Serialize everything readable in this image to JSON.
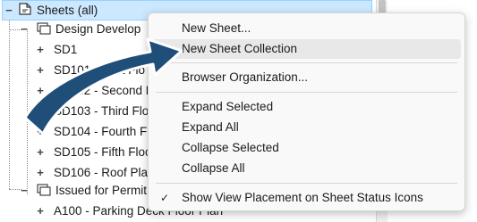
{
  "tree": {
    "root_label": "Sheets (all)",
    "groups": [
      {
        "label": "Design Develop",
        "items": [
          "SD1",
          "SD101 - First Flo",
          "SD102 - Second F",
          "SD103 - Third Flo",
          "SD104 - Fourth F",
          "SD105 - Fifth Floo",
          "SD106 - Roof Plar"
        ]
      },
      {
        "label": "Issued for Permit",
        "items": [
          "A100 - Parking Deck Floor Plan"
        ]
      }
    ]
  },
  "menu": {
    "items": [
      {
        "label": "New Sheet...",
        "highlighted": false,
        "checked": false
      },
      {
        "label": "New Sheet Collection",
        "highlighted": true,
        "checked": false
      },
      {
        "label": "Browser Organization...",
        "highlighted": false,
        "checked": false
      },
      {
        "label": "Expand Selected",
        "highlighted": false,
        "checked": false
      },
      {
        "label": "Expand All",
        "highlighted": false,
        "checked": false
      },
      {
        "label": "Collapse Selected",
        "highlighted": false,
        "checked": false
      },
      {
        "label": "Collapse All",
        "highlighted": false,
        "checked": false
      },
      {
        "label": "Show View Placement on Sheet Status Icons",
        "highlighted": false,
        "checked": true
      }
    ],
    "check_glyph": "✓"
  },
  "colors": {
    "selection_bg": "#cce8ff",
    "menu_highlight": "#e8e8e8",
    "arrow_fill": "#1f4e79"
  },
  "icons": {
    "root": "sheet-set-icon",
    "group": "sheet-collection-icon",
    "expand": "plus",
    "collapse": "minus"
  }
}
